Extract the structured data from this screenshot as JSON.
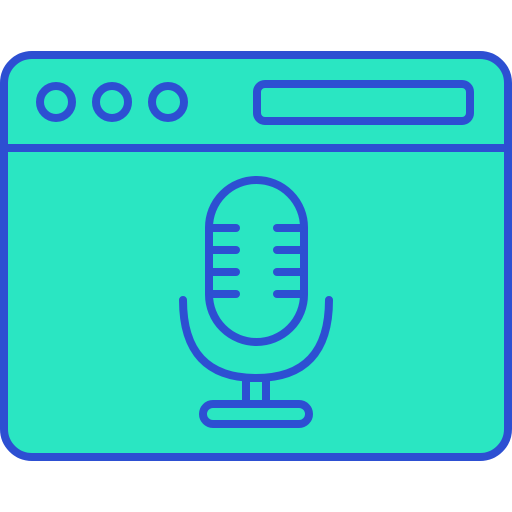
{
  "icon": {
    "name": "browser-window-microphone-icon",
    "colors": {
      "fill": "#2ae6c2",
      "stroke": "#2d4fd2",
      "background": "#ffffff"
    },
    "window_controls": [
      "dot-1",
      "dot-2",
      "dot-3"
    ],
    "elements": {
      "address_bar": "address-bar-icon",
      "microphone": "microphone-icon"
    }
  }
}
